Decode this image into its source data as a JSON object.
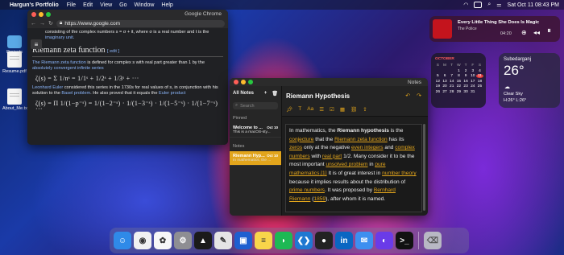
{
  "menubar": {
    "app": "Hargun's Portfolio",
    "items": [
      "File",
      "Edit",
      "View",
      "Go",
      "Window",
      "Help"
    ],
    "datetime": "Sat Oct 11 08:43 PM"
  },
  "desktop": {
    "icons": [
      {
        "label": "Projects"
      },
      {
        "label": "Resume.pdf"
      },
      {
        "label": "About_Me.txt"
      }
    ]
  },
  "chrome": {
    "title": "Google Chrome",
    "url": "https://www.google.com",
    "intro_line": "consisting of the complex numbers s = σ + it, where σ is a real number and t is the",
    "intro_tail": "imaginary unit.",
    "heading": "Riemann zeta function",
    "edit": "[ edit ]",
    "p1_link": "The Riemann zeta function",
    "p1_text": " is defined for complex s with real part greater than 1 by the ",
    "p1_link2": "absolutely convergent infinite series",
    "formula1": "ζ(s) = Σ 1/nˢ = 1/1ˢ + 1/2ˢ + 1/3ˢ + ···",
    "p2_link": "Leonhard Euler",
    "p2_text": " considered this series in the 1730s for real values of s, in conjunction with his solution to the ",
    "p2_link2": "Basel problem",
    "p2_text2": ". He also proved that it equals the ",
    "p2_link3": "Euler product",
    "formula2": "ζ(s) = Π 1/(1−p⁻ˢ) = 1/(1−2⁻ˢ) · 1/(1−3⁻ˢ) · 1/(1−5⁻ˢ) · 1/(1−7⁻ˢ) ···"
  },
  "notes": {
    "title": "Notes",
    "sidebar_title": "All Notes",
    "search_placeholder": "Search",
    "pinned_label": "Pinned",
    "notes_label": "Notes",
    "pinned_note": {
      "title": "Welcome to ...",
      "date": "Oct 10",
      "preview": "This is a macOS-sty..."
    },
    "active_note": {
      "title": "Riemann Hyp...",
      "date": "Oct 10",
      "preview": "In mathematics, the ..."
    },
    "editor_title": "Riemann Hypothesis",
    "body": [
      {
        "t": "In mathematics, the "
      },
      {
        "t": "Riemann hypothesis",
        "b": true
      },
      {
        "t": " is the "
      },
      {
        "t": "conjecture",
        "u": true
      },
      {
        "t": " that the "
      },
      {
        "t": "Riemann zeta function",
        "u": true
      },
      {
        "t": " has its "
      },
      {
        "t": "zeros",
        "u": true
      },
      {
        "t": " only at the negative "
      },
      {
        "t": "even integers",
        "u": true
      },
      {
        "t": " and "
      },
      {
        "t": "complex numbers",
        "u": true
      },
      {
        "t": " with "
      },
      {
        "t": "real part",
        "u": true
      },
      {
        "t": " 1/2. Many consider it to be the most important "
      },
      {
        "t": "unsolved problem",
        "u": true
      },
      {
        "t": " in "
      },
      {
        "t": "pure mathematics",
        "u": true
      },
      {
        "t": ".[1]",
        "u": true
      },
      {
        "t": " It is of great interest in "
      },
      {
        "t": "number theory",
        "u": true
      },
      {
        "t": " because it implies results about the distribution of "
      },
      {
        "t": "prime numbers",
        "u": true
      },
      {
        "t": ". It was proposed by "
      },
      {
        "t": "Bernhard Riemann",
        "u": true
      },
      {
        "t": " ("
      },
      {
        "t": "1859",
        "u": true
      },
      {
        "t": "), after whom it is named."
      }
    ]
  },
  "music": {
    "song": "Every Little Thing She Does Is Magic",
    "artist": "The Police",
    "time": "04:20"
  },
  "calendar": {
    "month": "OCTOBER",
    "days_header": [
      "S",
      "M",
      "T",
      "W",
      "T",
      "F",
      "S"
    ],
    "cells": [
      "",
      "",
      "",
      "1",
      "2",
      "3",
      "4",
      "5",
      "6",
      "7",
      "8",
      "9",
      "10",
      "11",
      "12",
      "13",
      "14",
      "15",
      "16",
      "17",
      "18",
      "19",
      "20",
      "21",
      "22",
      "23",
      "24",
      "25",
      "26",
      "27",
      "28",
      "29",
      "30",
      "31",
      ""
    ],
    "today": "11"
  },
  "weather": {
    "location": "Subedarganj",
    "temp": "26°",
    "condition": "Clear Sky",
    "hilo": "H:26° L:26°"
  },
  "dock": {
    "apps": [
      {
        "name": "finder-icon",
        "color": "#2f8ae8",
        "glyph": "☺"
      },
      {
        "name": "chrome-icon",
        "color": "#f1f1f1",
        "glyph": "◉"
      },
      {
        "name": "photos-icon",
        "color": "#f7f7f7",
        "glyph": "✿"
      },
      {
        "name": "settings-icon",
        "color": "#8e8e93",
        "glyph": "⚙"
      },
      {
        "name": "game-icon",
        "color": "#1a1a1a",
        "glyph": "▲"
      },
      {
        "name": "paint-icon",
        "color": "#e5e5e5",
        "glyph": "✎"
      },
      {
        "name": "photo-viewer-icon",
        "color": "#1e5fd0",
        "glyph": "▣"
      },
      {
        "name": "notes-icon",
        "color": "#f8d54a",
        "glyph": "≡"
      },
      {
        "name": "spotify-icon",
        "color": "#1db954",
        "glyph": "◗"
      },
      {
        "name": "vscode-icon",
        "color": "#1f78d1",
        "glyph": "❮❯"
      },
      {
        "name": "github-icon",
        "color": "#222222",
        "glyph": "●"
      },
      {
        "name": "linkedin-icon",
        "color": "#0a66c2",
        "glyph": "in"
      },
      {
        "name": "mail-icon",
        "color": "#3d8ff0",
        "glyph": "✉"
      },
      {
        "name": "siri-icon",
        "color": "#6a3be8",
        "glyph": "◐"
      },
      {
        "name": "terminal-icon",
        "color": "#111111",
        "glyph": ">_"
      }
    ],
    "trash": {
      "name": "trash-icon",
      "color": "#b8b8c4",
      "glyph": "🗑"
    }
  },
  "colors": {
    "accent": "#e2a51c",
    "link": "#8ab4f8",
    "today": "#e23b3b"
  }
}
